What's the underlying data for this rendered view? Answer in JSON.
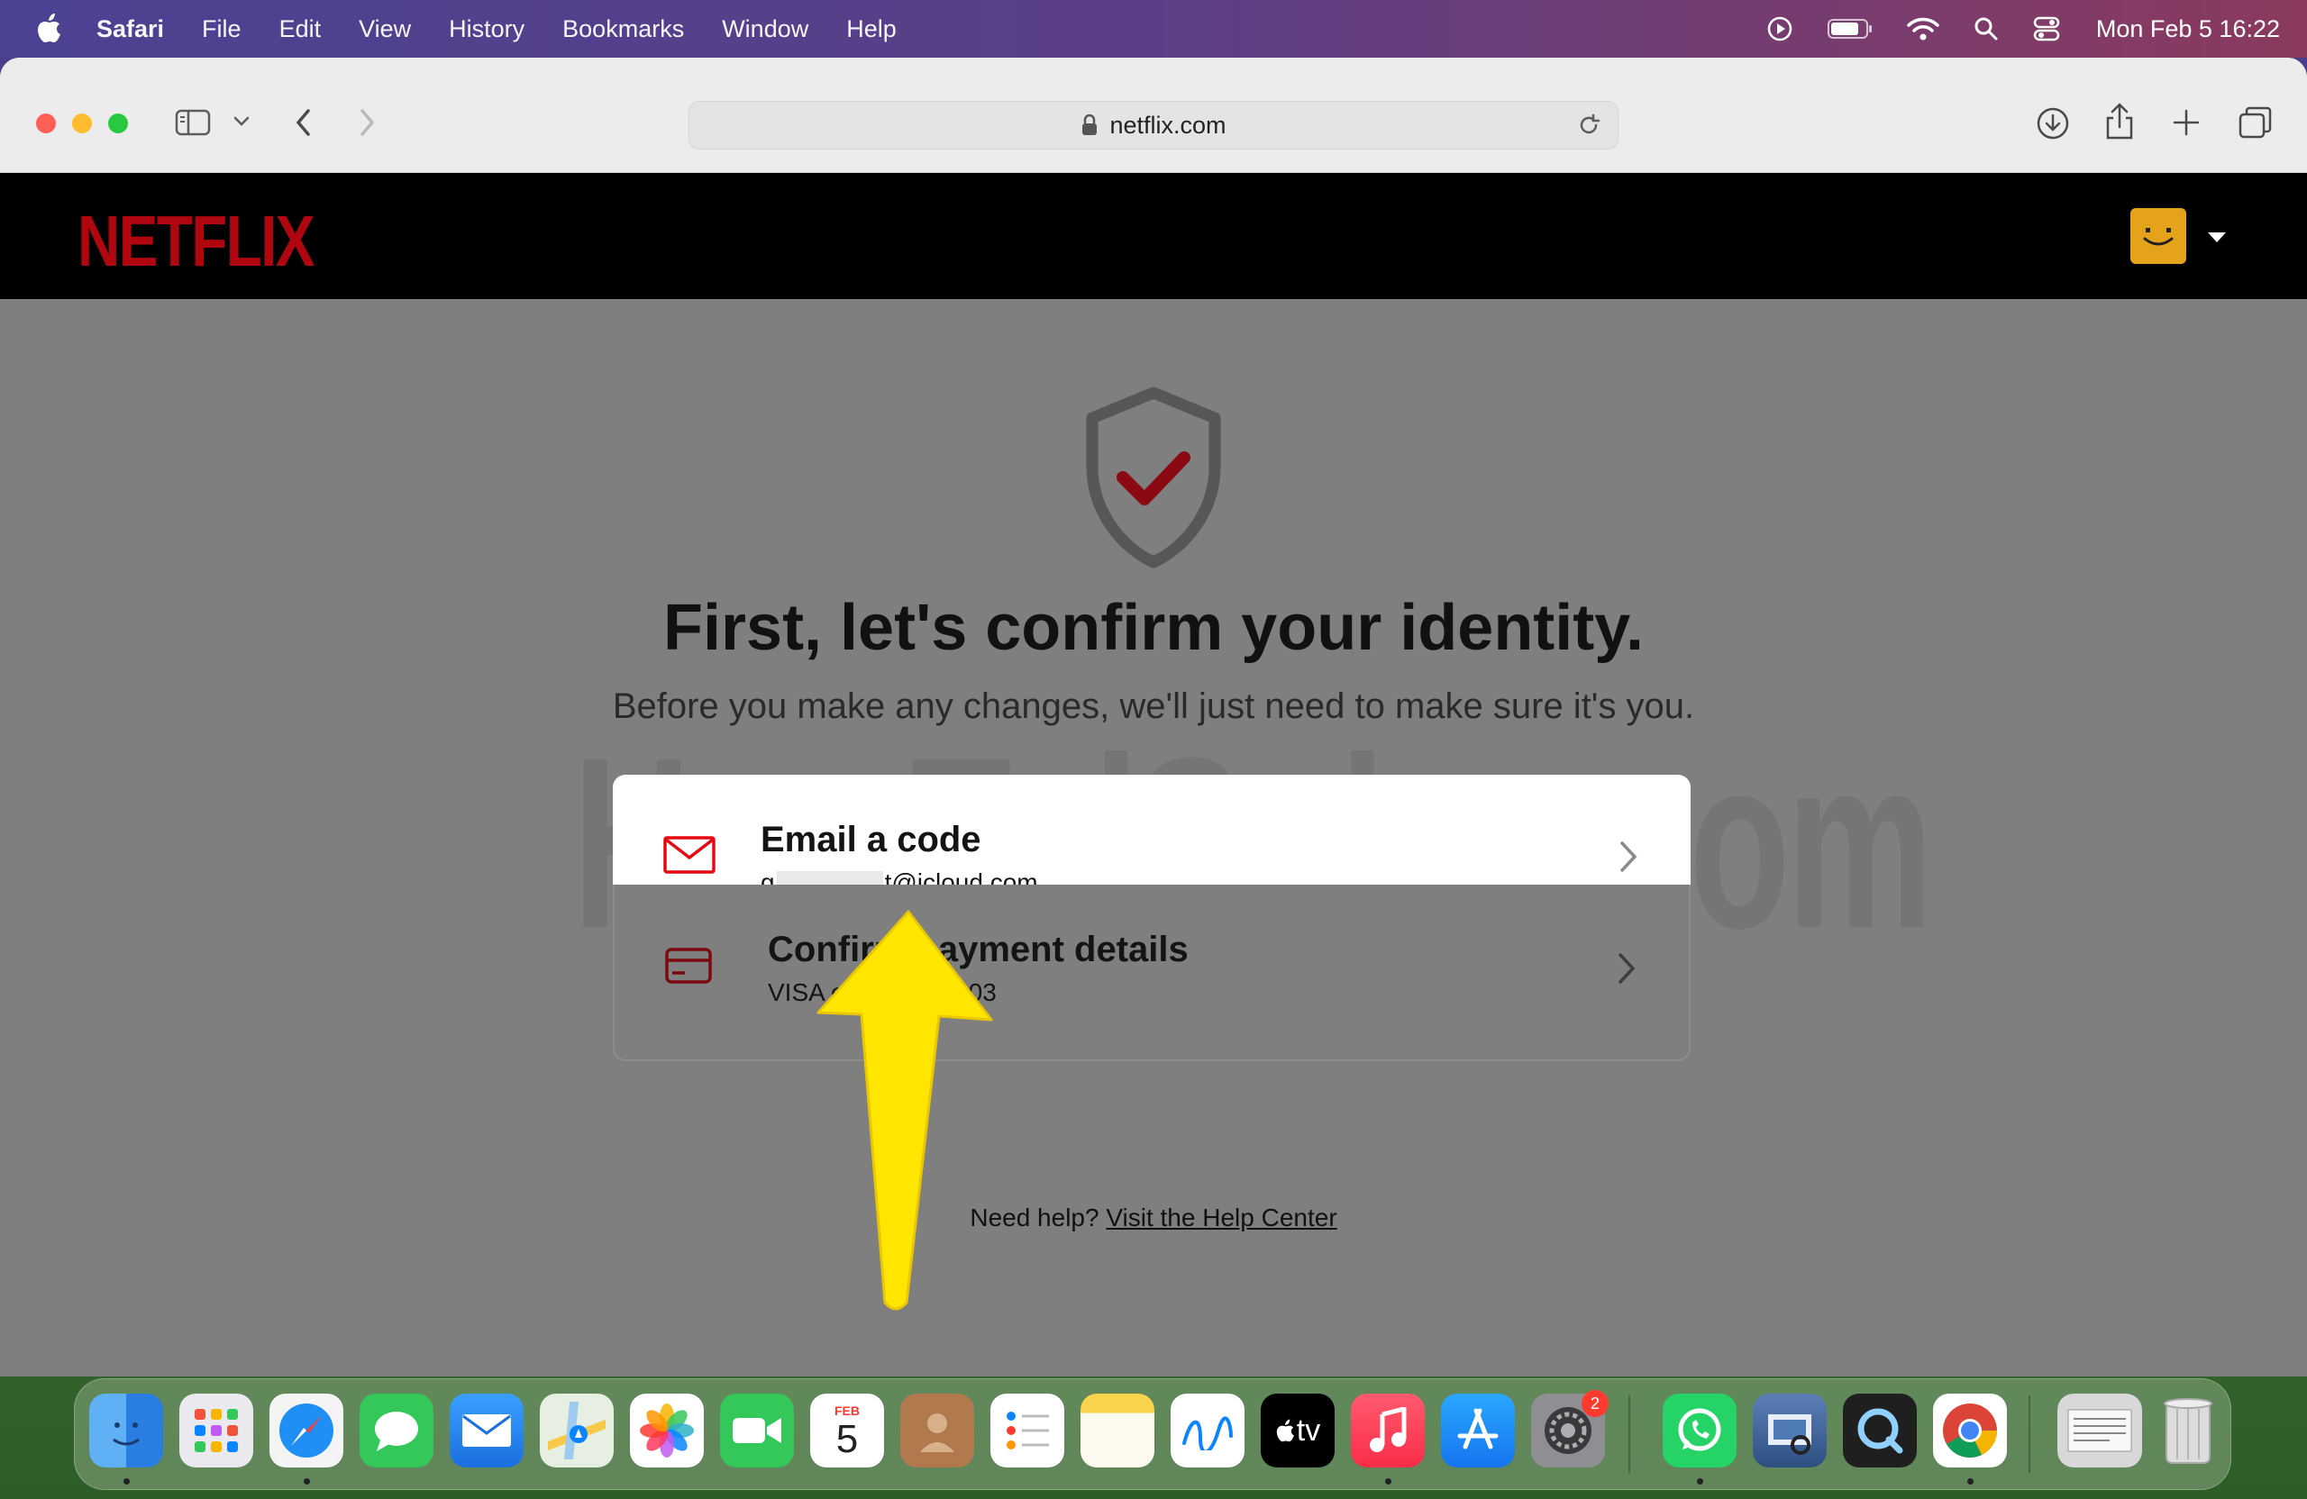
{
  "menubar": {
    "app_name": "Safari",
    "items": [
      "File",
      "Edit",
      "View",
      "History",
      "Bookmarks",
      "Window",
      "Help"
    ],
    "clock": "Mon Feb 5  16:22"
  },
  "browser": {
    "url": "netflix.com"
  },
  "netflix": {
    "logo": "NETFLIX",
    "watermark": "HowToiSolve.com",
    "headline": "First, let's confirm your identity.",
    "subhead": "Before you make any changes, we'll just need to make sure it's you.",
    "options": [
      {
        "title": "Email a code",
        "detail_prefix": "g",
        "detail_suffix": "t@icloud.com"
      },
      {
        "title": "Confirm payment details",
        "detail": "VISA ending in 2003"
      }
    ],
    "help_text": "Need help?",
    "help_link": "Visit the Help Center"
  },
  "dock": {
    "calendar_month": "FEB",
    "calendar_day": "5",
    "tv_label": "tv",
    "settings_badge": "2"
  },
  "colors": {
    "netflix_red": "#b0060f",
    "arrow": "#ffe600",
    "overlay": "#7f7f7f"
  }
}
